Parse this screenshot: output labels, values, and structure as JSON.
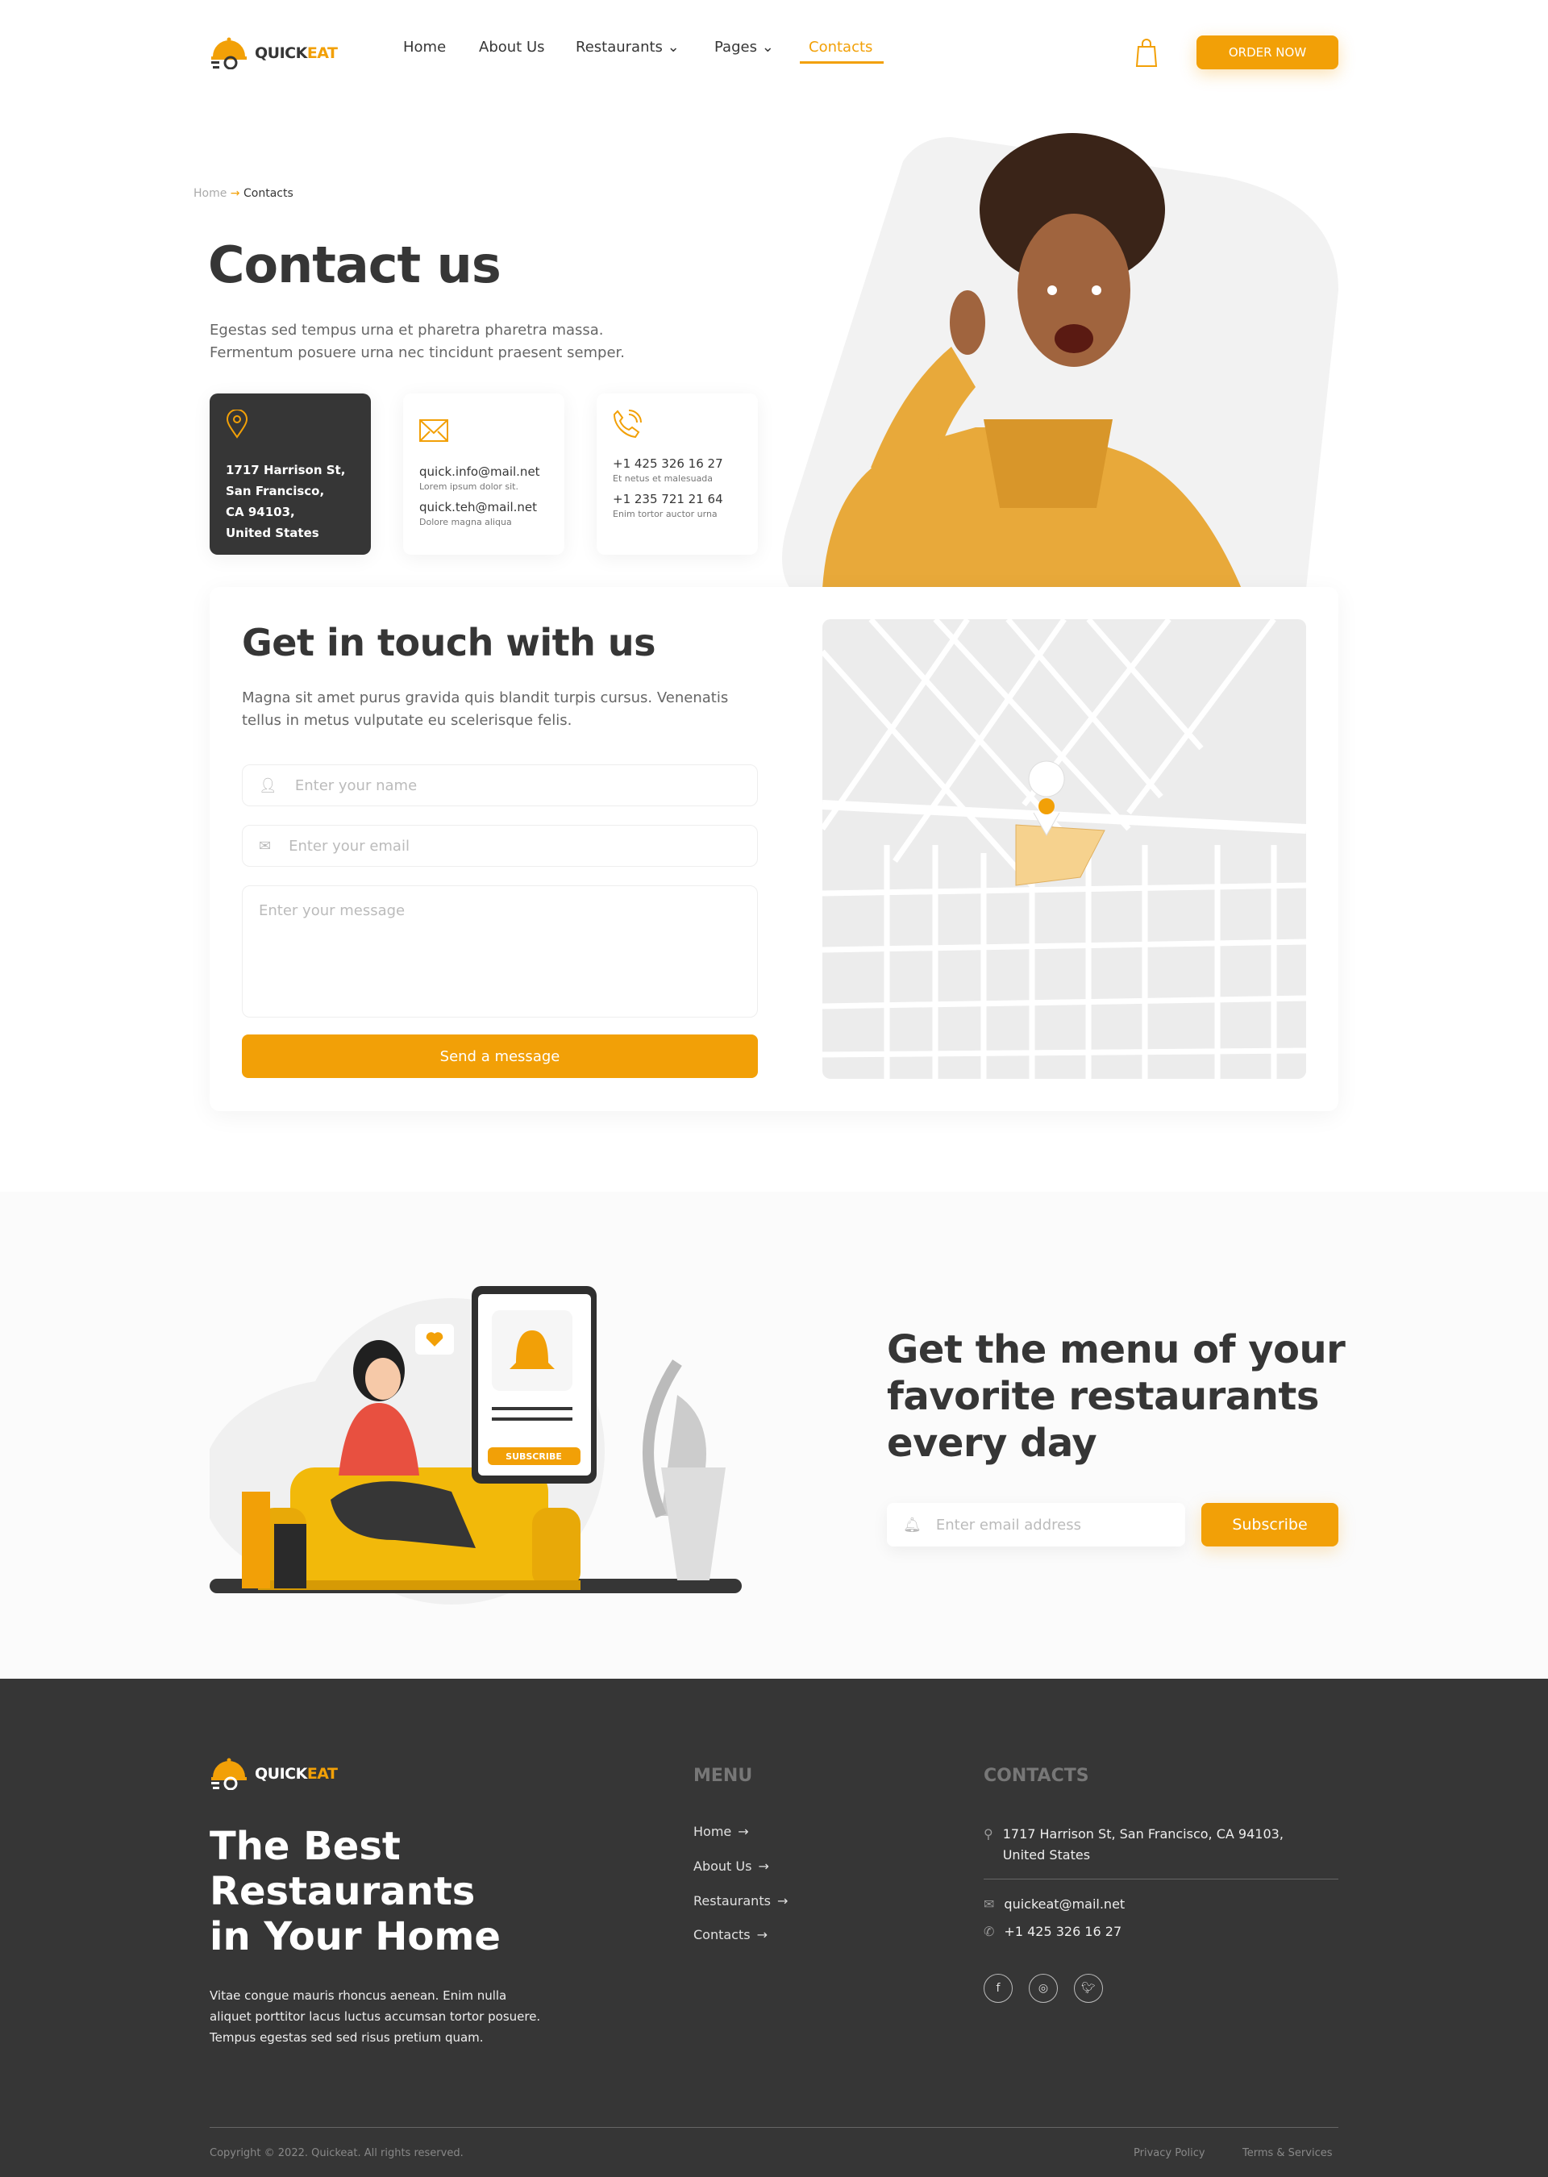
{
  "brand": {
    "name_a": "QUICK",
    "name_b": "EAT"
  },
  "colors": {
    "accent": "#f2a007",
    "dark": "#363636"
  },
  "nav": {
    "items": [
      {
        "label": "Home"
      },
      {
        "label": "About Us"
      },
      {
        "label": "Restaurants",
        "dropdown": true
      },
      {
        "label": "Pages",
        "dropdown": true
      },
      {
        "label": "Contacts",
        "active": true
      }
    ],
    "cart_icon": "shopping-bag-icon",
    "order_label": "ORDER NOW"
  },
  "breadcrumb": {
    "home": "Home",
    "sep": "→",
    "current": "Contacts"
  },
  "hero": {
    "title": "Contact us",
    "line1": "Egestas sed tempus urna et pharetra pharetra massa.",
    "line2": "Fermentum posuere urna nec tincidunt praesent semper."
  },
  "cards": {
    "address": {
      "icon": "location-pin-icon",
      "lines": [
        "1717 Harrison St,",
        "San Francisco,",
        "CA 94103,",
        "United States"
      ]
    },
    "email": {
      "icon": "envelope-icon",
      "e1": "quick.info@mail.net",
      "d1": "Lorem ipsum dolor sit.",
      "e2": "quick.teh@mail.net",
      "d2": "Dolore magna aliqua"
    },
    "phone": {
      "icon": "phone-icon",
      "p1": "+1 425 326 16 27",
      "d1": "Et netus et malesuada",
      "p2": "+1 235 721 21 64",
      "d2": "Enim tortor auctor urna"
    }
  },
  "form": {
    "title": "Get in touch with us",
    "desc1": "Magna sit amet purus gravida quis blandit turpis cursus. Venenatis",
    "desc2": "tellus in metus vulputate eu scelerisque felis.",
    "name_ph": "Enter your name",
    "email_ph": "Enter your email",
    "message_ph": "Enter your message",
    "submit": "Send a message"
  },
  "newsletter": {
    "l1": "Get the menu of your",
    "l2": "favorite restaurants",
    "l3": "every day",
    "email_ph": "Enter email address",
    "subscribe": "Subscribe",
    "phone_badge": "SUBSCRIBE"
  },
  "footer": {
    "t1": "The Best",
    "t2": "Restaurants",
    "t3": "in Your  Home",
    "p1": "Vitae congue mauris rhoncus aenean. Enim nulla",
    "p2": "aliquet porttitor lacus luctus accumsan tortor posuere.",
    "p3": "Tempus egestas sed sed risus pretium quam.",
    "menu_title": "MENU",
    "menu": [
      "Home",
      "About Us",
      "Restaurants",
      "Contacts"
    ],
    "contacts_title": "CONTACTS",
    "addr1": "1717 Harrison St, San Francisco, CA 94103,",
    "addr2": "United States",
    "email": "quickeat@mail.net",
    "phone": "+1 425 326 16 27",
    "social": [
      "facebook-icon",
      "instagram-icon",
      "twitter-icon"
    ],
    "copyright": "Copyright © 2022. Quickeat. All rights reserved.",
    "privacy": "Privacy Policy",
    "terms": "Terms & Services"
  }
}
